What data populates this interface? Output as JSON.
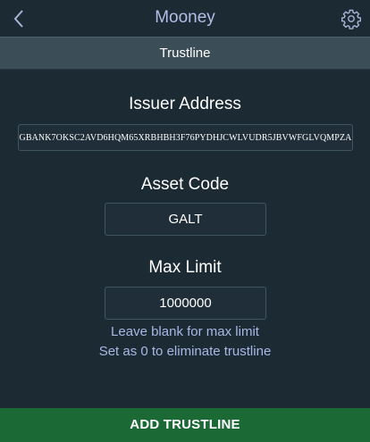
{
  "header": {
    "title": "Mooney",
    "back_icon": "chevron-left-icon",
    "settings_icon": "gear-icon"
  },
  "subheader": {
    "title": "Trustline"
  },
  "form": {
    "issuer_label": "Issuer Address",
    "issuer_value": "GBANK7OKSC2AVD6HQM65XRBHBH3F76PYDHJCWLVUDR5JBVWFGLVQMPZA",
    "asset_label": "Asset Code",
    "asset_value": "GALT",
    "limit_label": "Max Limit",
    "limit_value": "1000000",
    "hint_blank": "Leave blank for max limit",
    "hint_zero": "Set as 0 to eliminate trustline"
  },
  "footer": {
    "button_label": "ADD TRUSTLINE"
  },
  "colors": {
    "background": "#1c2a33",
    "subheader": "#3b4d57",
    "title_accent": "#b3bde6",
    "hint_text": "#aab7e6",
    "button_green": "#1b6a35"
  }
}
